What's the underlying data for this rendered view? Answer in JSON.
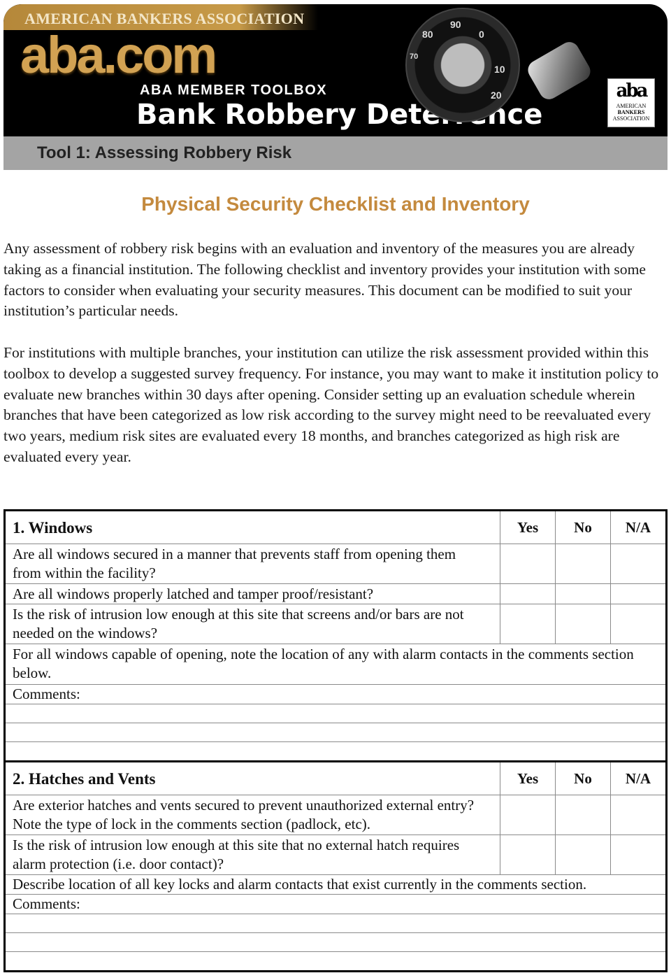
{
  "banner": {
    "org_name": "AMERICAN BANKERS ASSOCIATION",
    "site_name": "aba.com",
    "toolbox_label": "ABA MEMBER TOOLBOX",
    "title": "Bank Robbery Deterrence",
    "dial_marks": [
      "80",
      "90",
      "0",
      "10",
      "20",
      "70"
    ],
    "logo_mark": "aba",
    "logo_text": [
      "AMERICAN",
      "BANKERS",
      "ASSOCIATION"
    ],
    "colors": {
      "gold": "#c79a48",
      "background": "#000000"
    }
  },
  "tool_bar": {
    "title": "Tool 1:  Assessing Robbery Risk"
  },
  "doc_title": "Physical Security Checklist and Inventory",
  "paragraphs": [
    "Any assessment of robbery risk begins with an evaluation and inventory of the measures you are already taking as a financial institution.  The following checklist and inventory provides your institution with some factors to consider when evaluating your security measures.  This document can be modified to suit your institution’s particular needs.",
    "For institutions with multiple branches, your institution can utilize the risk assessment provided within this toolbox to develop a suggested survey frequency.  For instance, you may want to make it institution policy to evaluate new branches within 30 days after opening.  Consider setting up an evaluation schedule wherein branches that have been categorized as low risk according to the survey might need to be reevaluated every two years, medium risk sites are evaluated every 18 months, and branches categorized as high risk are evaluated every year."
  ],
  "columns": [
    "Yes",
    "No",
    "N/A"
  ],
  "sections": [
    {
      "title": "1.  Windows",
      "questions": [
        "Are all windows secured in a manner that prevents staff from opening them from within the facility?",
        "Are all windows properly latched and tamper proof/resistant?",
        "Is the risk of intrusion low enough at this site that screens and/or bars are not needed on the windows?"
      ],
      "note": "For all windows capable of opening, note the location of any with alarm contacts in the comments section below.",
      "comments_label": "Comments:"
    },
    {
      "title": "2.  Hatches and Vents",
      "questions": [
        "Are exterior hatches and vents secured to prevent unauthorized external entry?  Note the type of lock in the comments section (padlock, etc).",
        "Is the risk of intrusion low enough at this site that no external hatch requires alarm protection (i.e. door contact)?"
      ],
      "note": "Describe location of all key locks and alarm contacts that exist currently in the comments section.",
      "comments_label": "Comments:"
    }
  ]
}
